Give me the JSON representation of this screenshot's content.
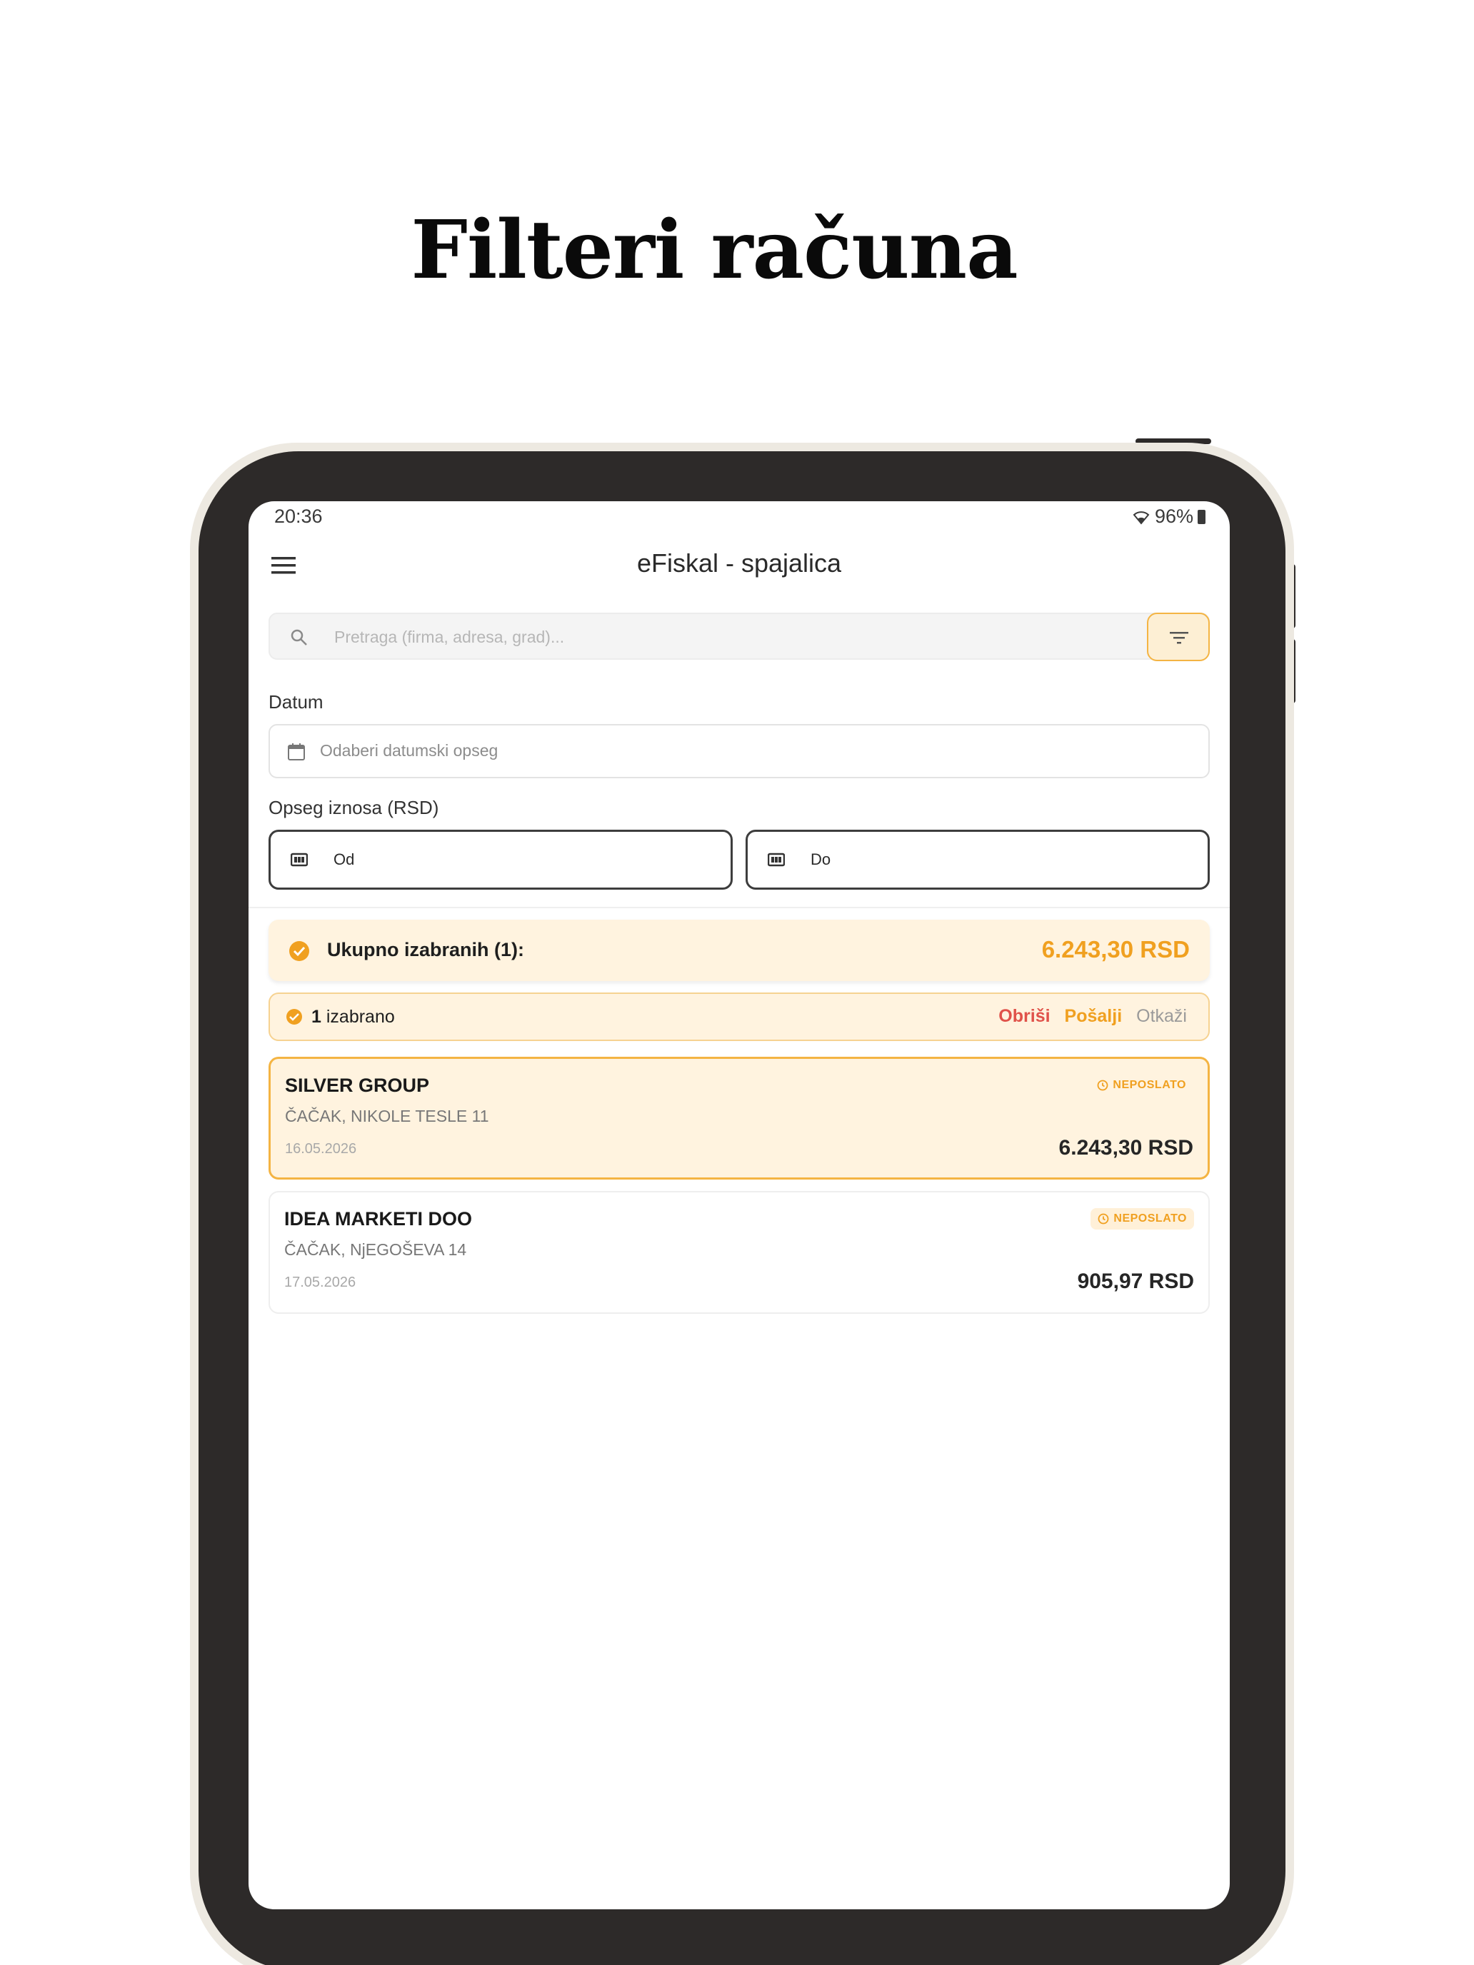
{
  "headline": "Filteri računa",
  "status_bar": {
    "time": "20:36",
    "battery": "96%"
  },
  "app_bar": {
    "title": "eFiskal - spajalica"
  },
  "search": {
    "placeholder": "Pretraga (firma, adresa, grad)..."
  },
  "filters": {
    "date_label": "Datum",
    "date_placeholder": "Odaberi datumski opseg",
    "amount_label": "Opseg iznosa (RSD)",
    "amount_from": "Od",
    "amount_to": "Do"
  },
  "summary": {
    "label": "Ukupno izabranih (1):",
    "value": "6.243,30 RSD"
  },
  "selection_bar": {
    "count": "1",
    "text": "izabrano",
    "delete": "Obriši",
    "send": "Pošalji",
    "cancel": "Otkaži"
  },
  "invoices": [
    {
      "name": "SILVER GROUP",
      "address": "ČAČAK, NIKOLE TESLE 11",
      "date": "16.05.2026",
      "amount": "6.243,30 RSD",
      "status": "NEPOSLATO",
      "selected": true
    },
    {
      "name": "IDEA MARKETI DOO",
      "address": "ČAČAK, NjEGOŠEVA 14",
      "date": "17.05.2026",
      "amount": "905,97 RSD",
      "status": "NEPOSLATO",
      "selected": false
    }
  ],
  "colors": {
    "accent": "#f0a020",
    "accent_light": "#fff3df",
    "danger": "#e0524a",
    "device_frame": "#2d2a29"
  }
}
